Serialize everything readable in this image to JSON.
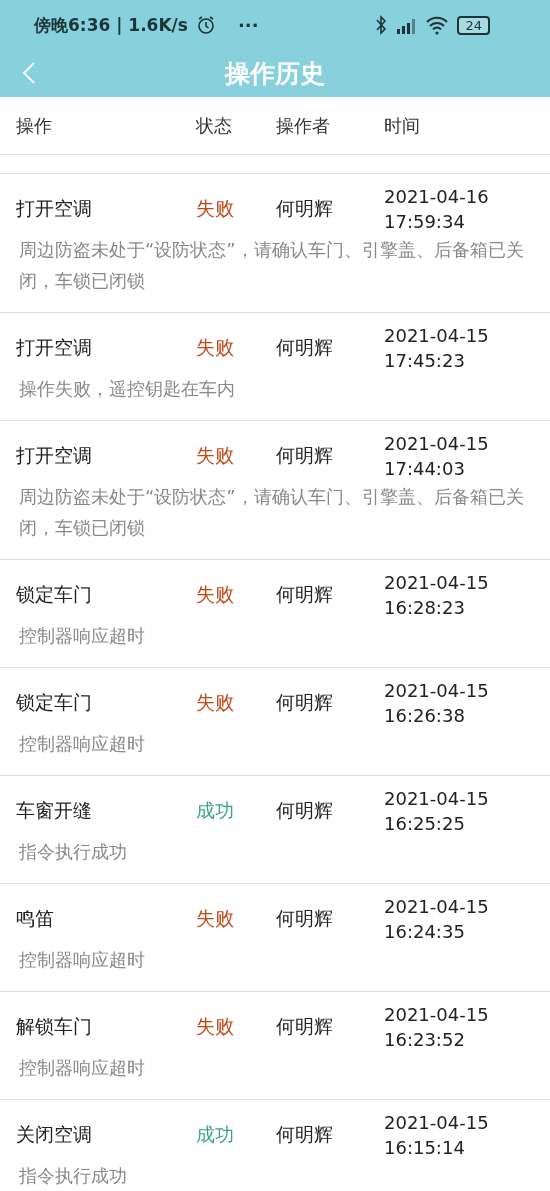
{
  "status_bar": {
    "time": "傍晚6:36 | 1.6K/s",
    "more": "···",
    "battery": "24"
  },
  "header": {
    "title": "操作历史"
  },
  "table": {
    "columns": [
      "操作",
      "状态",
      "操作者",
      "时间"
    ],
    "rows": [
      {
        "action": "打开空调",
        "status": "失败",
        "success": false,
        "operator": "何明辉",
        "date": "2021-04-16",
        "time": "17:59:34",
        "detail": "周边防盗未处于“设防状态”，请确认车门、引擎盖、后备箱已关闭，车锁已闭锁"
      },
      {
        "action": "打开空调",
        "status": "失败",
        "success": false,
        "operator": "何明辉",
        "date": "2021-04-15",
        "time": "17:45:23",
        "detail": "操作失败，遥控钥匙在车内"
      },
      {
        "action": "打开空调",
        "status": "失败",
        "success": false,
        "operator": "何明辉",
        "date": "2021-04-15",
        "time": "17:44:03",
        "detail": "周边防盗未处于“设防状态”，请确认车门、引擎盖、后备箱已关闭，车锁已闭锁"
      },
      {
        "action": "锁定车门",
        "status": "失败",
        "success": false,
        "operator": "何明辉",
        "date": "2021-04-15",
        "time": "16:28:23",
        "detail": "控制器响应超时"
      },
      {
        "action": "锁定车门",
        "status": "失败",
        "success": false,
        "operator": "何明辉",
        "date": "2021-04-15",
        "time": "16:26:38",
        "detail": "控制器响应超时"
      },
      {
        "action": "车窗开缝",
        "status": "成功",
        "success": true,
        "operator": "何明辉",
        "date": "2021-04-15",
        "time": "16:25:25",
        "detail": "指令执行成功"
      },
      {
        "action": "鸣笛",
        "status": "失败",
        "success": false,
        "operator": "何明辉",
        "date": "2021-04-15",
        "time": "16:24:35",
        "detail": "控制器响应超时"
      },
      {
        "action": "解锁车门",
        "status": "失败",
        "success": false,
        "operator": "何明辉",
        "date": "2021-04-15",
        "time": "16:23:52",
        "detail": "控制器响应超时"
      },
      {
        "action": "关闭空调",
        "status": "成功",
        "success": true,
        "operator": "何明辉",
        "date": "2021-04-15",
        "time": "16:15:14",
        "detail": "指令执行成功"
      }
    ]
  }
}
